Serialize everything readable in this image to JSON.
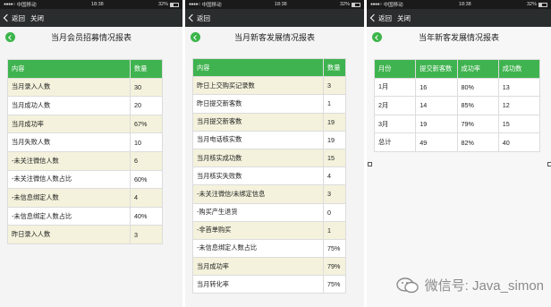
{
  "status_bar": [
    {
      "carrier": "中国移动",
      "time": "18:38",
      "battery": "32%"
    },
    {
      "carrier": "中国移动",
      "time": "18:38",
      "battery": "32%"
    },
    {
      "carrier": "中国移动",
      "time": "18:38",
      "battery": "32%"
    }
  ],
  "phone1": {
    "nav": {
      "back": "返回",
      "close": "关闭"
    },
    "title": "当月会员招募情况报表",
    "headers": [
      "内容",
      "数量"
    ],
    "rows": [
      [
        "当月录入人数",
        "30"
      ],
      [
        "当月成功人数",
        "20"
      ],
      [
        "当月成功率",
        "67%"
      ],
      [
        "当月失败人数",
        "10"
      ],
      [
        "-未关注微信人数",
        "6"
      ],
      [
        "-未关注微信人数占比",
        "60%"
      ],
      [
        "-未信息绑定人数",
        "4"
      ],
      [
        "-未信息绑定人数占比",
        "40%"
      ],
      [
        "昨日录入人数",
        "3"
      ]
    ]
  },
  "phone2": {
    "nav": {
      "back": "返回"
    },
    "title": "当月新客发展情况报表",
    "headers": [
      "内容",
      "数量"
    ],
    "rows": [
      [
        "昨日上交购买记录数",
        "3"
      ],
      [
        "昨日提交新客数",
        "1"
      ],
      [
        "当月提交新客数",
        "19"
      ],
      [
        "当月电话核实数",
        "19"
      ],
      [
        "当月核实成功数",
        "15"
      ],
      [
        "当月核实失败数",
        "4"
      ],
      [
        "-未关注微信/未绑定信息",
        "3"
      ],
      [
        "-购买产生退货",
        "0"
      ],
      [
        "-非首单购买",
        "1"
      ],
      [
        "-未信息绑定人数占比",
        "75%"
      ],
      [
        "当月成功率",
        "79%"
      ],
      [
        "当月转化率",
        "75%"
      ]
    ]
  },
  "phone3": {
    "nav": {
      "back": "返回",
      "close": "关闭"
    },
    "title": "当年新客发展情况报表",
    "headers": [
      "月份",
      "提交新客数",
      "成功率",
      "成功数"
    ],
    "rows": [
      [
        "1月",
        "16",
        "80%",
        "13"
      ],
      [
        "2月",
        "14",
        "85%",
        "12"
      ],
      [
        "3月",
        "19",
        "79%",
        "15"
      ],
      [
        "总计",
        "49",
        "82%",
        "40"
      ]
    ]
  },
  "watermark": "微信号: Java_simon"
}
